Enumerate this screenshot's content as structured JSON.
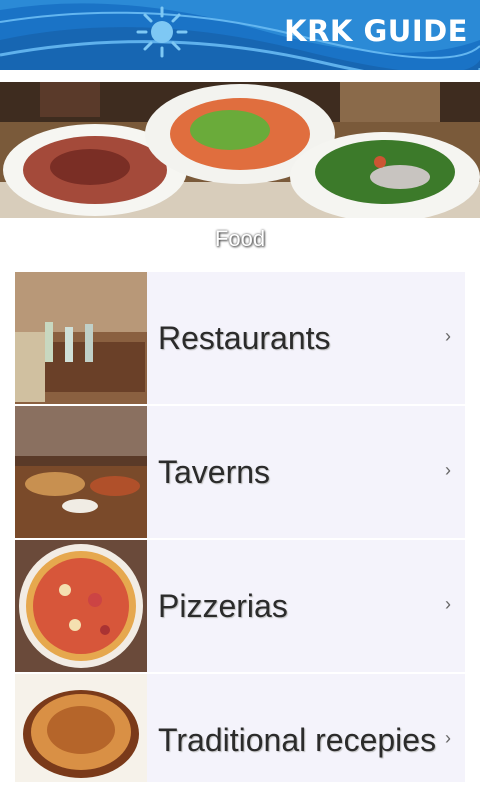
{
  "header": {
    "title": "KRK GUIDE",
    "accent": "#1a73c6"
  },
  "section": {
    "caption": "Food"
  },
  "items": [
    {
      "label": "Restaurants",
      "icon": "chevron-right-icon"
    },
    {
      "label": "Taverns",
      "icon": "chevron-right-icon"
    },
    {
      "label": "Pizzerias",
      "icon": "chevron-right-icon"
    },
    {
      "label": "Traditional recepies",
      "icon": "chevron-right-icon"
    }
  ],
  "chevron": "›"
}
